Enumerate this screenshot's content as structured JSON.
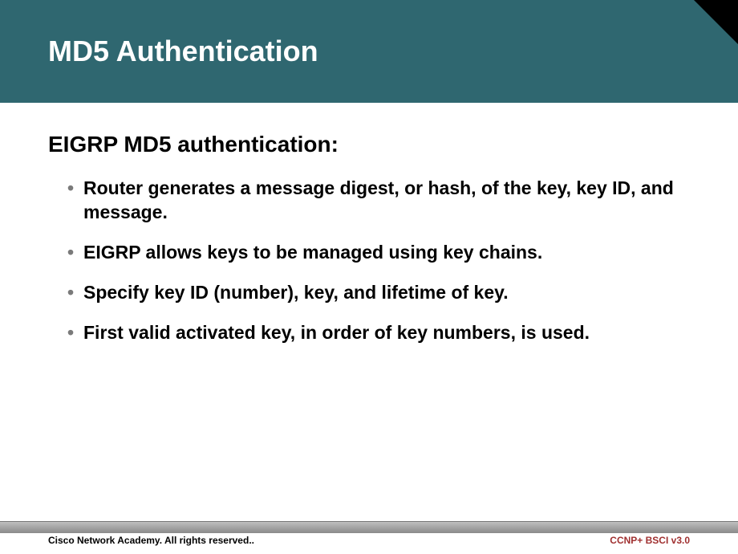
{
  "header": {
    "title": "MD5 Authentication"
  },
  "content": {
    "subtitle": "EIGRP MD5 authentication:",
    "bullets": [
      "Router generates a message digest, or hash, of the key, key ID, and message.",
      "EIGRP allows keys to be managed using key chains.",
      "Specify key ID (number), key, and lifetime of key.",
      "First valid activated key, in order of key numbers, is used."
    ]
  },
  "footer": {
    "left": "Cisco Network Academy. All rights reserved..",
    "right": "CCNP+ BSCI v3.0"
  }
}
